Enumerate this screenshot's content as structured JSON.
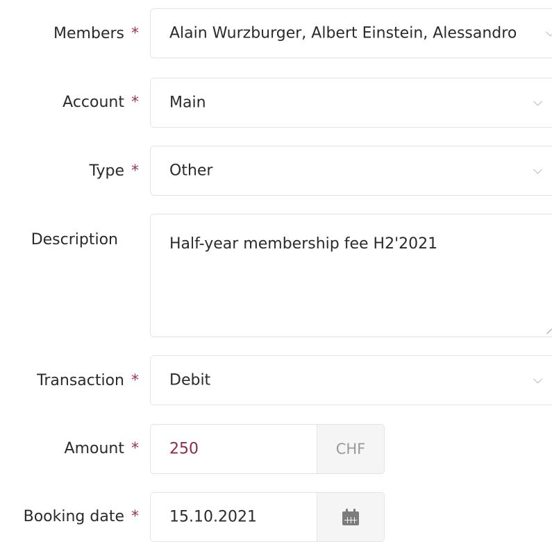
{
  "form": {
    "members": {
      "label": "Members",
      "required_mark": "*",
      "value": "Alain Wurzburger, Albert Einstein, Alessandro"
    },
    "account": {
      "label": "Account",
      "required_mark": "*",
      "value": "Main"
    },
    "type": {
      "label": "Type",
      "required_mark": "*",
      "value": "Other"
    },
    "description": {
      "label": "Description",
      "value": "Half-year membership fee H2'2021"
    },
    "transaction": {
      "label": "Transaction",
      "required_mark": "*",
      "value": "Debit"
    },
    "amount": {
      "label": "Amount",
      "required_mark": "*",
      "value": "250",
      "currency": "CHF"
    },
    "booking_date": {
      "label": "Booking date",
      "required_mark": "*",
      "value": "15.10.2021"
    }
  },
  "colors": {
    "required": "#a0305a",
    "amount_text": "#8b2a4c",
    "border": "#e3e3e3",
    "addon_bg": "#f5f5f5"
  },
  "icons": {
    "select_arrow": "chevron-down-icon",
    "date_picker": "calendar-icon"
  }
}
